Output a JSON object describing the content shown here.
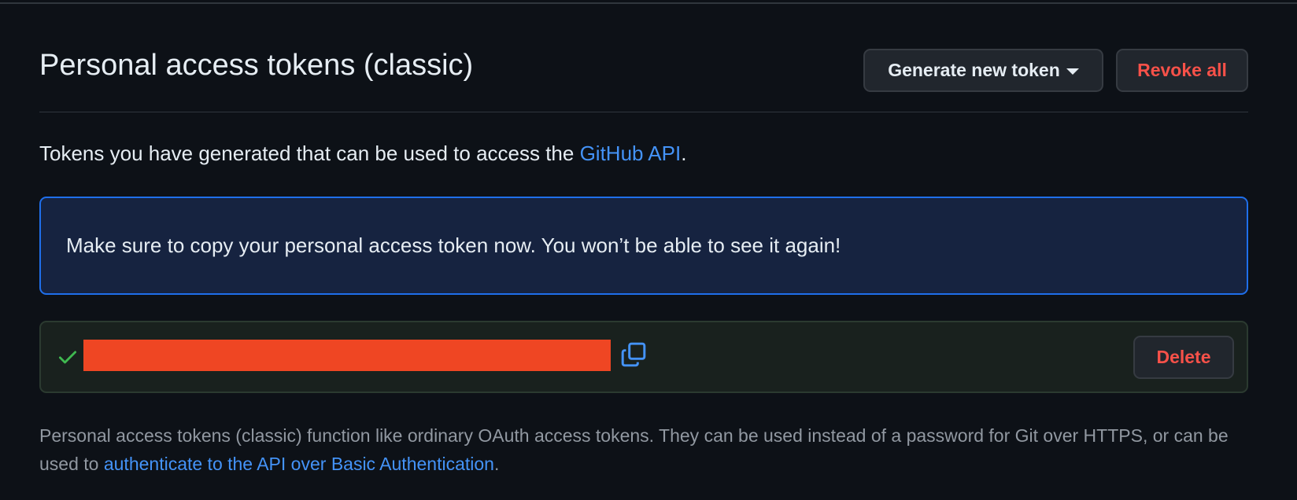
{
  "header": {
    "title": "Personal access tokens (classic)",
    "generate_label": "Generate new token",
    "revoke_label": "Revoke all"
  },
  "intro": {
    "text_before": "Tokens you have generated that can be used to access the ",
    "link_text": "GitHub API",
    "text_after": "."
  },
  "flash": {
    "message": "Make sure to copy your personal access token now. You won’t be able to see it again!"
  },
  "token": {
    "value": "",
    "redacted": true,
    "delete_label": "Delete"
  },
  "footnote": {
    "text_before": "Personal access tokens (classic) function like ordinary OAuth access tokens. They can be used instead of a password for Git over HTTPS, or can be used to ",
    "link_text": "authenticate to the API over Basic Authentication",
    "text_after": "."
  },
  "icons": {
    "dropdown": "triangle-down-icon",
    "check": "check-icon",
    "copy": "copy-icon"
  },
  "colors": {
    "background": "#0d1117",
    "text": "#e6edf3",
    "muted_text": "#9198a1",
    "link": "#4493f8",
    "danger": "#f85149",
    "success": "#3fb950",
    "info_bg": "#162340",
    "info_border": "#1f6feb",
    "redaction": "#ef4623"
  }
}
